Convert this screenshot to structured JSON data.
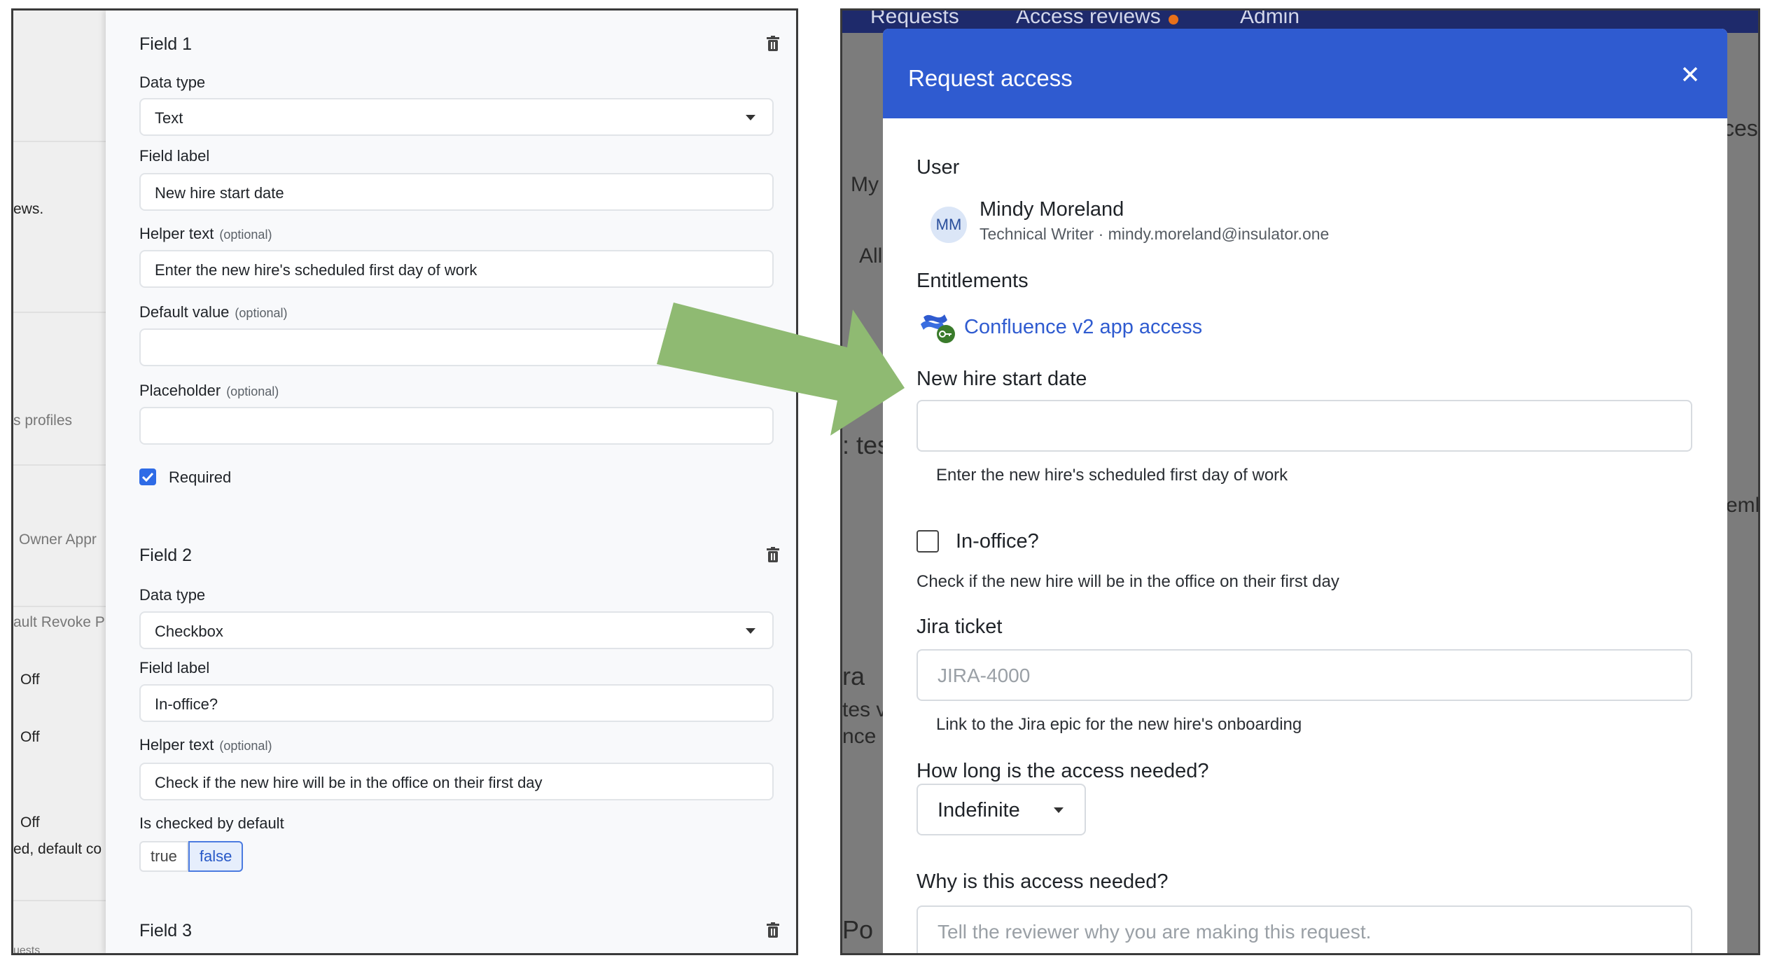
{
  "left": {
    "background_texts": [
      "ews.",
      "s profiles",
      "Owner Appr",
      "ault Revoke P",
      "Off",
      "Off",
      "Off",
      "ed, default co",
      "uests"
    ],
    "field1": {
      "title": "Field 1",
      "data_type_label": "Data type",
      "data_type_value": "Text",
      "field_label_label": "Field label",
      "field_label_value": "New hire start date",
      "helper_label": "Helper text",
      "helper_optional": "(optional)",
      "helper_value": "Enter the new hire's scheduled first day of work",
      "default_label": "Default value",
      "default_optional": "(optional)",
      "placeholder_label": "Placeholder",
      "placeholder_optional": "(optional)",
      "required_label": "Required"
    },
    "field2": {
      "title": "Field 2",
      "data_type_label": "Data type",
      "data_type_value": "Checkbox",
      "field_label_label": "Field label",
      "field_label_value": "In-office?",
      "helper_label": "Helper text",
      "helper_optional": "(optional)",
      "helper_value": "Check if the new hire will be in the office on their first day",
      "checked_label": "Is checked by default",
      "toggle_true": "true",
      "toggle_false": "false"
    },
    "field3": {
      "title": "Field 3"
    }
  },
  "right": {
    "nav": {
      "requests": "Requests",
      "access_reviews": "Access reviews",
      "admin": "Admin"
    },
    "background_texts": [
      "ces",
      "My",
      "All",
      ": tes",
      "emb",
      "ra",
      "tes v",
      "nce",
      "Po"
    ],
    "modal": {
      "title": "Request access",
      "user_label": "User",
      "user_initials": "MM",
      "user_name": "Mindy Moreland",
      "user_detail": "Technical Writer · mindy.moreland@insulator.one",
      "entitlements_label": "Entitlements",
      "entitlement_name": "Confluence v2 app access",
      "field1_label": "New hire start date",
      "field1_helper": "Enter the new hire's scheduled first day of work",
      "field2_label": "In-office?",
      "field2_helper": "Check if the new hire will be in the office on their first day",
      "jira_label": "Jira ticket",
      "jira_placeholder": "JIRA-4000",
      "jira_helper": "Link to the Jira epic for the new hire's onboarding",
      "duration_label": "How long is the access needed?",
      "duration_value": "Indefinite",
      "reason_label": "Why is this access needed?",
      "reason_placeholder": "Tell the reviewer why you are making this request."
    }
  },
  "colors": {
    "accent": "#2f5bd0",
    "arrow": "#8fba72",
    "link": "#2f5bd0",
    "checkbox": "#2e6be6"
  }
}
